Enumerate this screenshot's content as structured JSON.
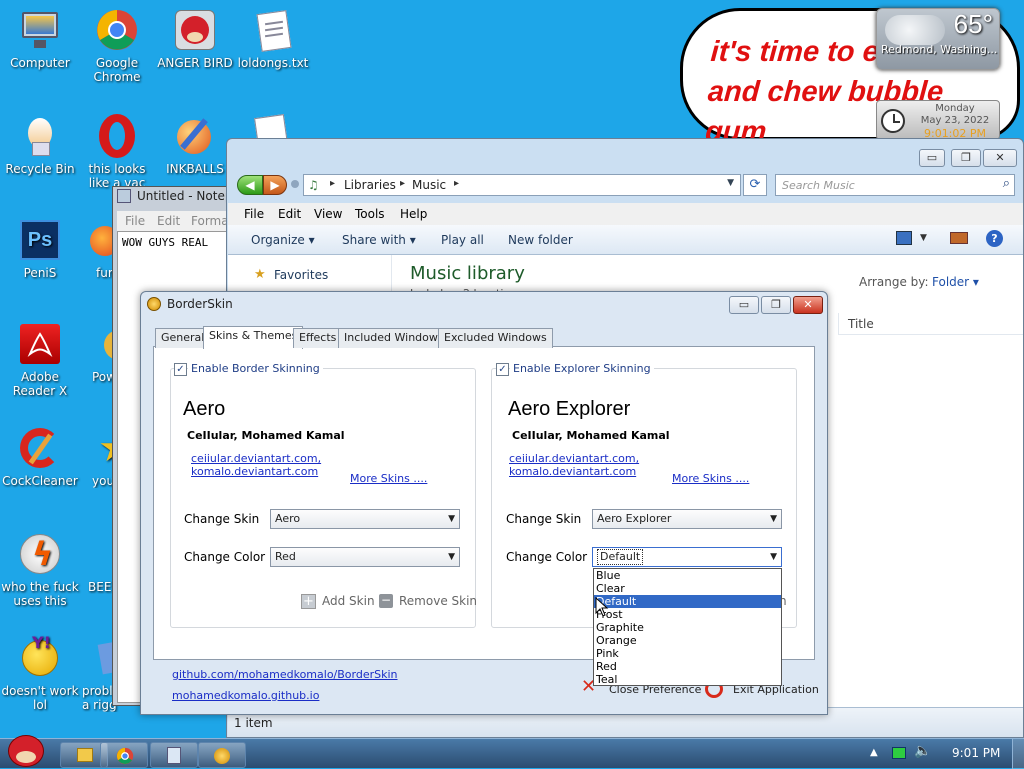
{
  "desktop": {
    "icons": [
      {
        "label": "Computer",
        "icon": "computer-icon"
      },
      {
        "label": "Google Chrome",
        "icon": "chrome-icon"
      },
      {
        "label": "ANGER BIRD",
        "icon": "angry-bird-icon"
      },
      {
        "label": "loldongs.txt",
        "icon": "text-file-icon"
      },
      {
        "label": "Recycle Bin",
        "icon": "recycle-bin-icon"
      },
      {
        "label": "this looks like a vac",
        "icon": "opera-icon"
      },
      {
        "label": "INKBALLS",
        "icon": "inkball-icon"
      },
      {
        "label": "PeniS",
        "icon": "photoshop-icon"
      },
      {
        "label": "fur",
        "icon": "firefox-icon"
      },
      {
        "label": "Adobe Reader X",
        "icon": "adobe-reader-icon"
      },
      {
        "label": "Pow",
        "icon": "powerpoint-icon"
      },
      {
        "label": "CockCleaner",
        "icon": "ccleaner-icon"
      },
      {
        "label": "you",
        "icon": "star-icon"
      },
      {
        "label": "who the fuck uses this",
        "icon": "winamp-icon"
      },
      {
        "label": "BEE",
        "icon": "bee-icon"
      },
      {
        "label": "doesn't work lol",
        "icon": "yahoo-messenger-icon"
      },
      {
        "label": "probl a rigg",
        "icon": "folder-icon"
      }
    ],
    "bubble_text": "it's time to e and die and chew bubble gum"
  },
  "gadgets": {
    "weather": {
      "temp": "65°",
      "location": "Redmond, Washing..."
    },
    "clock": {
      "day": "Monday",
      "date": "May 23, 2022",
      "time": "9:01:02 PM"
    }
  },
  "notepad": {
    "title": "Untitled - Notep",
    "menu": [
      "File",
      "Edit",
      "Forma"
    ],
    "text": "WOW GUYS REAL"
  },
  "explorer": {
    "breadcrumb": [
      "Libraries",
      "Music"
    ],
    "search_placeholder": "Search Music",
    "menu": [
      "File",
      "Edit",
      "View",
      "Tools",
      "Help"
    ],
    "toolbar": [
      "Organize",
      "Share with",
      "Play all",
      "New folder"
    ],
    "nav_favorites": "Favorites",
    "library_title": "Music library",
    "library_sub": "Includes: 2 locations",
    "arrange_label": "Arrange by:",
    "arrange_value": "Folder",
    "column_title": "Title",
    "status": "1 item"
  },
  "borderskin": {
    "title": "BorderSkin",
    "tabs": [
      "General",
      "Skins & Themes",
      "Effects",
      "Included Windows",
      "Excluded Windows"
    ],
    "active_tab": "Skins & Themes",
    "left": {
      "enable_label": "Enable Border Skinning",
      "enabled": true,
      "skin_name": "Aero",
      "author": "CeIIular, Mohamed Kamal",
      "link1": "ceiiular.deviantart.com,",
      "link2": "komalo.deviantart.com",
      "more": "More Skins ....",
      "change_skin_label": "Change Skin",
      "change_skin_value": "Aero",
      "change_color_label": "Change Color",
      "change_color_value": "Red",
      "add_skin": "Add Skin",
      "remove_skin": "Remove Skin"
    },
    "right": {
      "enable_label": "Enable Explorer Skinning",
      "enabled": true,
      "skin_name": "Aero Explorer",
      "author": "CeIIular, Mohamed Kamal",
      "link1": "ceiiular.deviantart.com,",
      "link2": "komalo.deviantart.com",
      "more": "More Skins ....",
      "change_skin_label": "Change Skin",
      "change_skin_value": "Aero Explorer",
      "change_color_label": "Change Color",
      "change_color_value": "Default",
      "color_options": [
        "Blue",
        "Clear",
        "Default",
        "Frost",
        "Graphite",
        "Orange",
        "Pink",
        "Red",
        "Teal"
      ],
      "highlighted_option": "Default",
      "remove_partial": "n"
    },
    "footer": {
      "github_link": "github.com/mohamedkomalo/BorderSkin",
      "io_link": "mohamedkomalo.github.io",
      "close_pref": "Close Preference",
      "exit_app": "Exit Application"
    }
  },
  "taskbar": {
    "time": "9:01 PM"
  },
  "colors": {
    "desktop_bg": "#1ea6e8",
    "bubble_text": "#e01010",
    "link": "#1a2dc6",
    "highlight": "#3169c6",
    "library_title": "#1e5b2a"
  }
}
